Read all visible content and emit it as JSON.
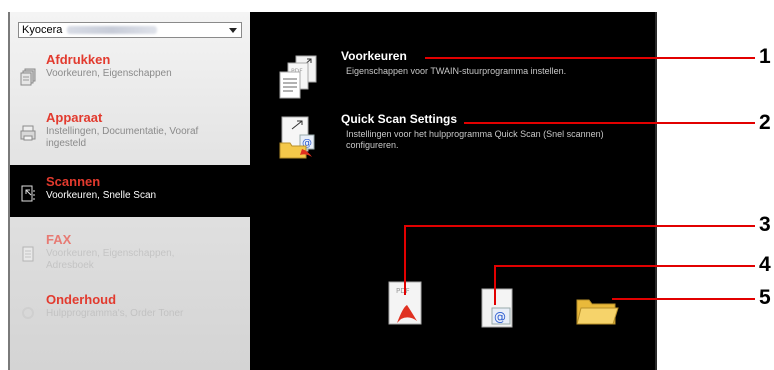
{
  "device": {
    "selected": "Kyocera"
  },
  "sidebar": {
    "items": [
      {
        "title": "Afdrukken",
        "subtitle": "Voorkeuren, Eigenschappen",
        "icon": "printer-docs-icon"
      },
      {
        "title": "Apparaat",
        "subtitle": "Instellingen, Documentatie, Vooraf ingesteld",
        "icon": "printer-device-icon"
      },
      {
        "title": "Scannen",
        "subtitle": "Voorkeuren, Snelle Scan",
        "icon": "scan-doc-icon",
        "active": true
      },
      {
        "title": "FAX",
        "subtitle": "Voorkeuren, Eigenschappen, Adresboek",
        "icon": "fax-icon"
      },
      {
        "title": "Onderhoud",
        "subtitle": "Hulpprogramma's, Order Toner",
        "icon": "maintenance-icon"
      }
    ]
  },
  "main": {
    "entries": [
      {
        "title": "Voorkeuren",
        "desc": "Eigenschappen voor TWAIN-stuurprogramma instellen.",
        "icon": "twain-docs-icon"
      },
      {
        "title": "Quick Scan Settings",
        "desc": "Instellingen voor het hulpprogramma Quick Scan (Snel scannen) configureren.",
        "icon": "quick-scan-icon"
      }
    ],
    "bottom_icons": [
      {
        "name": "scan-to-pdf-icon",
        "label": "PDF"
      },
      {
        "name": "scan-to-email-icon",
        "label": "@"
      },
      {
        "name": "scan-to-folder-icon"
      }
    ]
  },
  "callouts": [
    "1",
    "2",
    "3",
    "4",
    "5"
  ],
  "colors": {
    "accent_red": "#e23a2e",
    "callout_red": "#e20000",
    "panel_black": "#000000"
  }
}
